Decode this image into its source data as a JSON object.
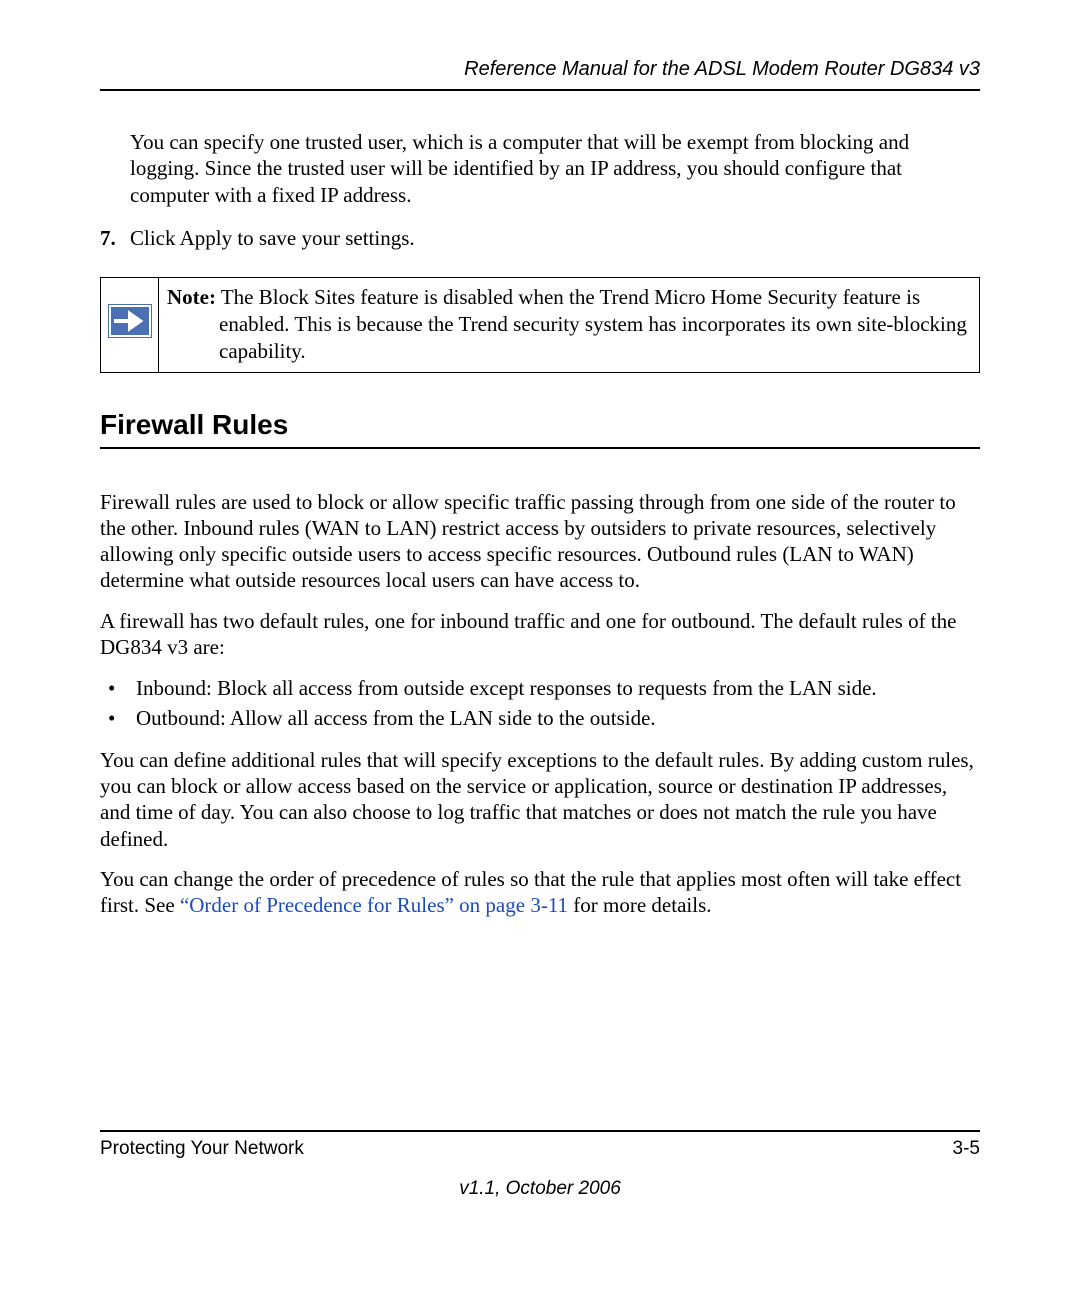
{
  "header": {
    "title": "Reference Manual for the ADSL Modem Router DG834 v3"
  },
  "intro": {
    "paragraph": "You can specify one trusted user, which is a computer that will be exempt from blocking and logging. Since the trusted user will be identified by an IP address, you should configure that computer with a fixed IP address."
  },
  "step": {
    "number": "7.",
    "text": "Click Apply to save your settings."
  },
  "note": {
    "label": "Note:",
    "line1": " The Block Sites feature is disabled when the Trend Micro Home Security feature is",
    "rest": "enabled. This is because the Trend security system has incorporates its own site-blocking capability."
  },
  "section": {
    "heading": "Firewall Rules",
    "para1": "Firewall rules are used to block or allow specific traffic passing through from one side of the router to the other. Inbound rules (WAN to LAN) restrict access by outsiders to private resources, selectively allowing only specific outside users to access specific resources. Outbound rules (LAN to WAN) determine what outside resources local users can have access to.",
    "para2": "A firewall has two default rules, one for inbound traffic and one for outbound. The default rules of the DG834 v3 are:",
    "bullets": [
      "Inbound: Block all access from outside except responses to requests from the LAN side.",
      "Outbound: Allow all access from the LAN side to the outside."
    ],
    "para3": "You can define additional rules that will specify exceptions to the default rules. By adding custom rules, you can block or allow access based on the service or application, source or destination IP addresses, and time of day. You can also choose to log traffic that matches or does not match the rule you have defined.",
    "para4a": "You can change the order of precedence of rules so that the rule that applies most often will take effect first. See ",
    "crossref": "“Order of Precedence for Rules” on page 3-11",
    "para4b": " for more details."
  },
  "footer": {
    "left": "Protecting Your Network",
    "right": "3-5",
    "version": "v1.1, October 2006"
  }
}
